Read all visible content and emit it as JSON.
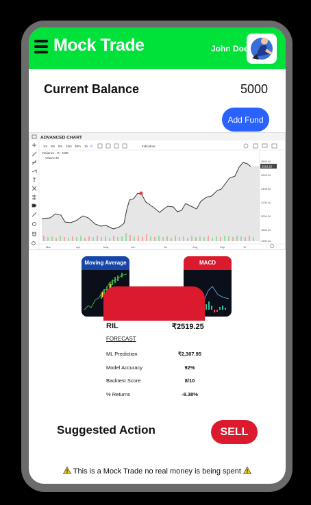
{
  "app": {
    "title": "Mock Trade",
    "user_name": "John Doe"
  },
  "balance": {
    "label": "Current Balance",
    "value": "5000",
    "add_fund_label": "Add Fund"
  },
  "chart_widget": {
    "title": "ADVANCED CHART",
    "intervals": [
      "1m",
      "3m",
      "5m",
      "15m",
      "30m",
      "1h",
      "D"
    ],
    "indicators_label": "Indicators",
    "symbol_line": "Reliance · D · NSE",
    "volume_line": "Volume 20",
    "months": [
      "Mar",
      "Apr",
      "May",
      "Jun",
      "Jul",
      "Aug",
      "Sep",
      "12"
    ],
    "price_ticks": [
      "2800.00",
      "2600.00",
      "2400.00",
      "2200.00",
      "2000.00",
      "1800.00",
      "1600.00"
    ],
    "last_price_tag": "2519.25",
    "colors": {
      "line": "#333333",
      "area": "#e6e6e6",
      "volume_up": "#9ed9a4",
      "volume_down": "#f2a6a6"
    }
  },
  "indicators": [
    {
      "label": "Moving Average",
      "header_color": "#1646a8"
    },
    {
      "label": "MACD",
      "header_color": "#dc1a2d"
    }
  ],
  "stock": {
    "name": "RIL",
    "price": "₹2519.25",
    "forecast_label": "FORECAST",
    "rows": [
      {
        "label": "ML Prediction",
        "value": "₹2,307.95"
      },
      {
        "label": "Model Accuracy",
        "value": "92%"
      },
      {
        "label": "Backtest Score",
        "value": "8/10"
      },
      {
        "label": "% Returns",
        "value": "-8.38%"
      }
    ]
  },
  "action": {
    "label": "Suggested Action",
    "button_label": "SELL",
    "button_color": "#dc1a2d"
  },
  "disclaimer": {
    "text": "This is a Mock Trade no real money is being spent",
    "icon": "warning-icon"
  },
  "theme": {
    "accent": "#00e13a",
    "primary_button": "#2962ff",
    "danger": "#dc1a2d"
  }
}
